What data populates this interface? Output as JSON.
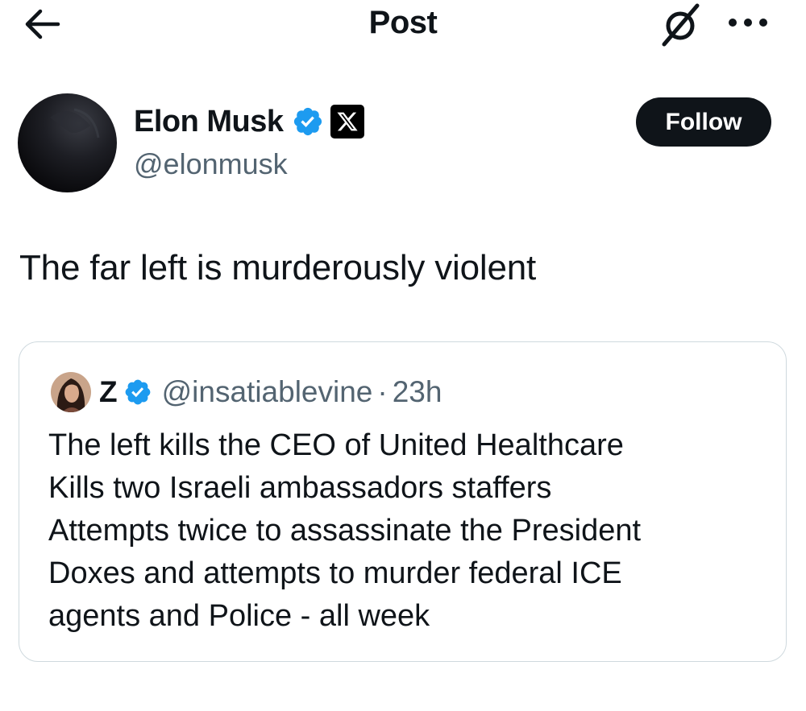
{
  "header": {
    "title": "Post",
    "back_icon": "arrow-left-icon",
    "grok_icon": "grok-icon",
    "more_icon": "more-horizontal-icon"
  },
  "post": {
    "author_name": "Elon Musk",
    "author_handle": "@elonmusk",
    "verified_icon": "verified-badge-icon",
    "affiliate_icon": "x-logo-icon",
    "follow_label": "Follow",
    "text": "The far left is murderously violent"
  },
  "quote": {
    "author_name": "Z",
    "author_handle": "@insatiablevine",
    "separator": "·",
    "time": "23h",
    "lines": [
      "The left kills the CEO of United Healthcare",
      "Kills two Israeli ambassadors staffers",
      "Attempts twice to assassinate the President",
      "Doxes and attempts to murder federal ICE",
      "agents and Police - all week"
    ]
  },
  "colors": {
    "text_primary": "#0f1419",
    "text_secondary": "#536471",
    "verified_blue": "#1d9bf0",
    "border": "#cfd9de",
    "button_bg": "#0f1419"
  }
}
